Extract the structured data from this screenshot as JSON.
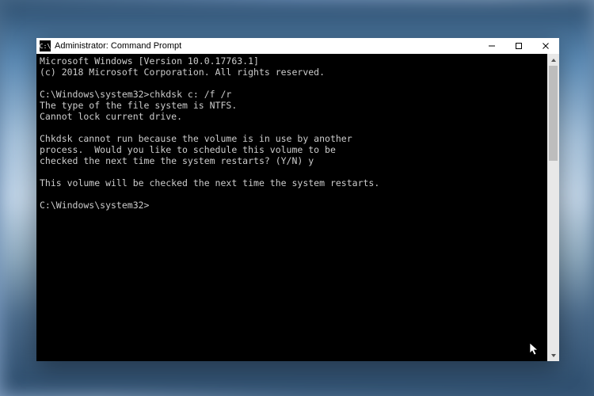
{
  "window": {
    "title": "Administrator: Command Prompt",
    "icon_glyph": "C:\\"
  },
  "terminal": {
    "lines": {
      "l0": "Microsoft Windows [Version 10.0.17763.1]",
      "l1": "(c) 2018 Microsoft Corporation. All rights reserved.",
      "l2": "",
      "l3": "C:\\Windows\\system32>chkdsk c: /f /r",
      "l4": "The type of the file system is NTFS.",
      "l5": "Cannot lock current drive.",
      "l6": "",
      "l7": "Chkdsk cannot run because the volume is in use by another",
      "l8": "process.  Would you like to schedule this volume to be",
      "l9": "checked the next time the system restarts? (Y/N) y",
      "l10": "",
      "l11": "This volume will be checked the next time the system restarts.",
      "l12": "",
      "l13": "C:\\Windows\\system32>"
    }
  }
}
